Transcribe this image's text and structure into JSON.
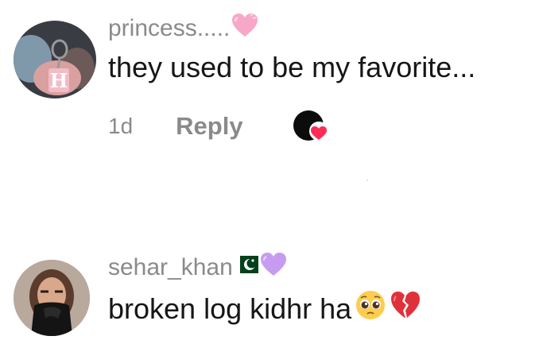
{
  "comments": [
    {
      "username": "princess.....",
      "username_emoji": "pink-heart",
      "text": "they used to be my favorite...",
      "time": "1d",
      "reply_label": "Reply"
    },
    {
      "username": "sehar_khan",
      "username_emoji": [
        "pakistan-flag",
        "purple-heart"
      ],
      "text": "broken log kidhr ha",
      "text_emoji": [
        "pleading-face",
        "broken-heart"
      ]
    }
  ],
  "colors": {
    "username": "#8a8a8a",
    "text": "#161616",
    "like_heart": "#fe2c55",
    "pink_heart": "#f7a8c9",
    "purple_heart": "#c79cf0",
    "broken_heart": "#e0313a"
  }
}
